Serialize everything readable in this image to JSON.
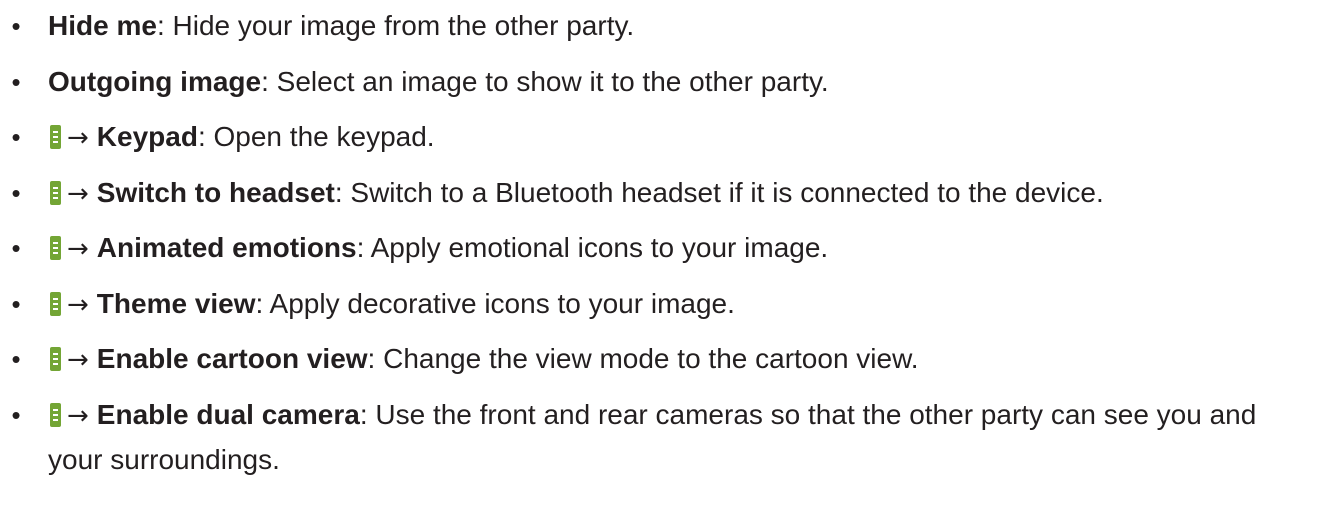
{
  "items": [
    {
      "term": "Hide me",
      "desc": ": Hide your image from the other party."
    },
    {
      "term": "Outgoing image",
      "desc": ": Select an image to show it to the other party."
    },
    {
      "arrow": "→",
      "term": "Keypad",
      "desc": ": Open the keypad."
    },
    {
      "arrow": "→",
      "term": "Switch to headset",
      "desc": ": Switch to a Bluetooth headset if it is connected to the device."
    },
    {
      "arrow": "→",
      "term": "Animated emotions",
      "desc": ": Apply emotional icons to your image."
    },
    {
      "arrow": "→",
      "term": "Theme view",
      "desc": ": Apply decorative icons to your image."
    },
    {
      "arrow": "→",
      "term": "Enable cartoon view",
      "desc": ": Change the view mode to the cartoon view."
    },
    {
      "arrow": "→",
      "term": "Enable dual camera",
      "desc": ": Use the front and rear cameras so that the other party can see you and your surroundings."
    }
  ],
  "bullet": "•",
  "colors": {
    "text": "#231f20",
    "menu_icon": "#73a535"
  },
  "icons": {
    "menu": "more-options-icon"
  }
}
